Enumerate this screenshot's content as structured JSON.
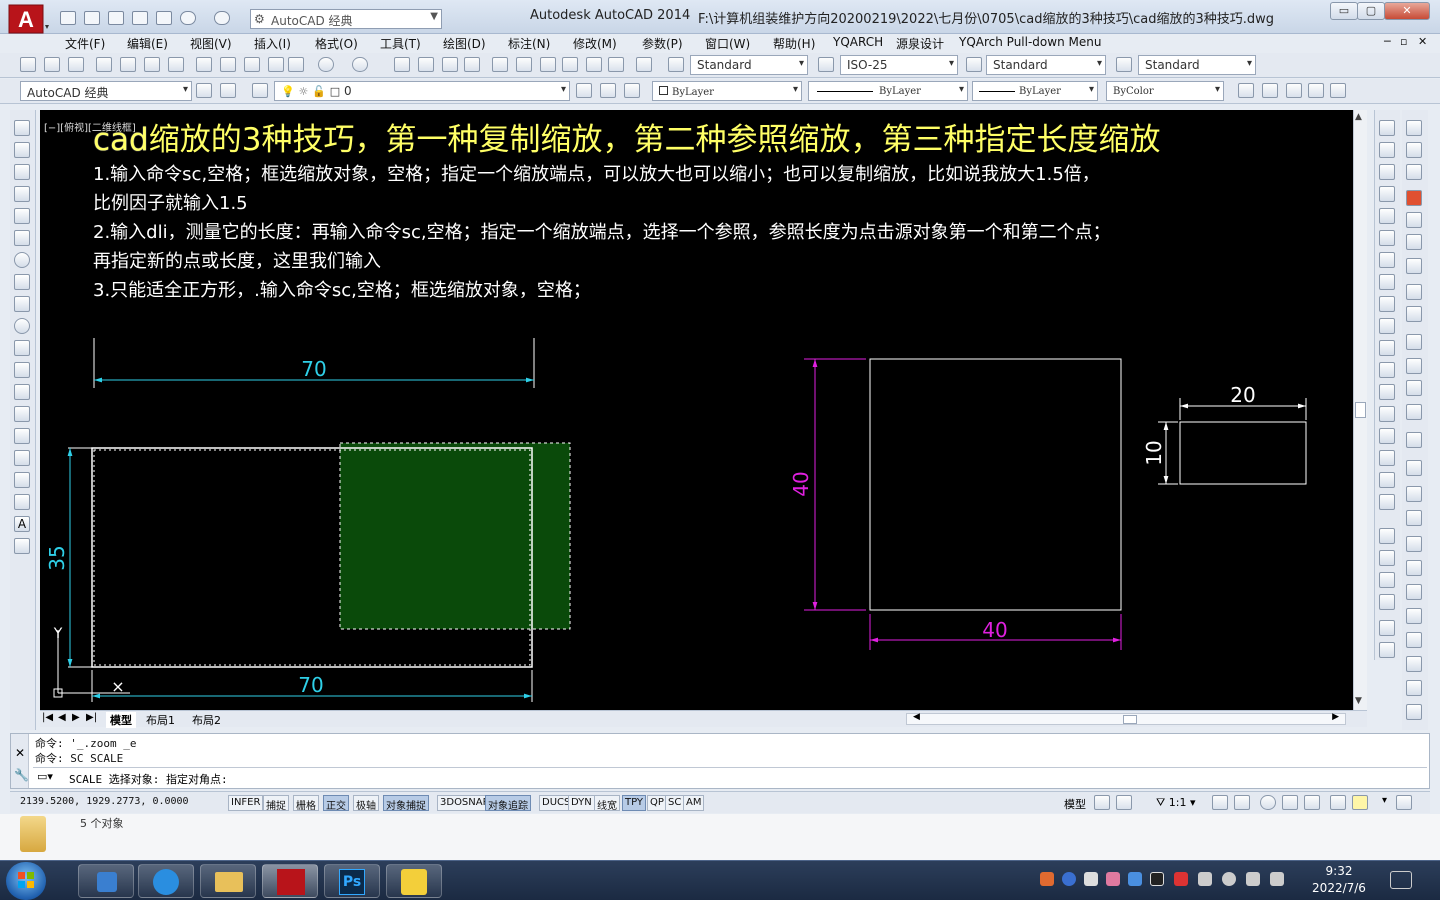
{
  "window": {
    "app_title": "Autodesk AutoCAD 2014",
    "file_path": "F:\\计算机组装维护方向20200219\\2022\\七月份\\0705\\cad缩放的3种技巧\\cad缩放的3种技巧.dwg",
    "workspace": "AutoCAD 经典",
    "logo_letter": "A",
    "controls": {
      "minimize": "▭",
      "restore": "▢",
      "close": "✕"
    }
  },
  "menu": [
    "文件(F)",
    "编辑(E)",
    "视图(V)",
    "插入(I)",
    "格式(O)",
    "工具(T)",
    "绘图(D)",
    "标注(N)",
    "修改(M)",
    "参数(P)",
    "窗口(W)",
    "帮助(H)",
    "YQARCH",
    "源泉设计",
    "YQArch Pull-down Menu"
  ],
  "styles": {
    "text_style": "Standard",
    "dim_style": "ISO-25",
    "table_style": "Standard",
    "mleader_style": "Standard"
  },
  "layers": {
    "workspace": "AutoCAD 经典",
    "layer": "0",
    "color": "ByLayer",
    "linetype": "ByLayer",
    "lineweight": "ByLayer",
    "plotstyle": "ByColor"
  },
  "viewport_label": "[−][俯视][二维线框]",
  "drawing": {
    "heading_prefix": "cad",
    "heading_rest": "缩放的3种技巧，第一种复制缩放，第二种参照缩放，第三种指定长度缩放",
    "lines": [
      "1.输入命令sc,空格；框选缩放对象，空格；指定一个缩放端点，可以放大也可以缩小；也可以复制缩放，比如说我放大1.5倍，",
      "比例因子就输入1.5",
      "2.输入dli，测量它的长度：再输入命令sc,空格；指定一个缩放端点，选择一个参照，参照长度为点击源对象第一个和第二个点；",
      "再指定新的点或长度，这里我们输入",
      "3.只能适全正方形，.输入命令sc,空格；框选缩放对象，空格；"
    ],
    "dims": {
      "top_width": "70",
      "bottom_width": "70",
      "left_height": "35",
      "square_height": "40",
      "square_width": "40",
      "small_width": "20",
      "small_height": "10"
    },
    "colors": {
      "heading": "#ffff66",
      "dim_cyan": "#2fd0e8",
      "dim_magenta": "#e020e0",
      "selection_fill": "#0a4a0a"
    }
  },
  "tabs": [
    "模型",
    "布局1",
    "布局2"
  ],
  "command": {
    "history1": "命令: '_.zoom _e",
    "history2": "命令: SC SCALE",
    "prompt": "SCALE 选择对象: 指定对角点:"
  },
  "status": {
    "coords": "2139.5200, 1929.2773, 0.0000",
    "toggles": [
      {
        "label": "INFER",
        "on": false
      },
      {
        "label": "捕捉",
        "on": false
      },
      {
        "label": "栅格",
        "on": false
      },
      {
        "label": "正交",
        "on": true
      },
      {
        "label": "极轴",
        "on": false
      },
      {
        "label": "对象捕捉",
        "on": true
      },
      {
        "label": "3DOSNAP",
        "on": false
      },
      {
        "label": "对象追踪",
        "on": true
      },
      {
        "label": "DUCS",
        "on": false
      },
      {
        "label": "DYN",
        "on": false
      },
      {
        "label": "线宽",
        "on": false
      },
      {
        "label": "TPY",
        "on": true
      },
      {
        "label": "QP",
        "on": false
      },
      {
        "label": "SC",
        "on": false
      },
      {
        "label": "AM",
        "on": false
      }
    ],
    "model": "模型",
    "scale": "1:1"
  },
  "desktop": {
    "item_label": "5 个对象"
  },
  "taskbar": {
    "time": "9:32",
    "date": "2022/7/6",
    "app_ps": "Ps"
  }
}
